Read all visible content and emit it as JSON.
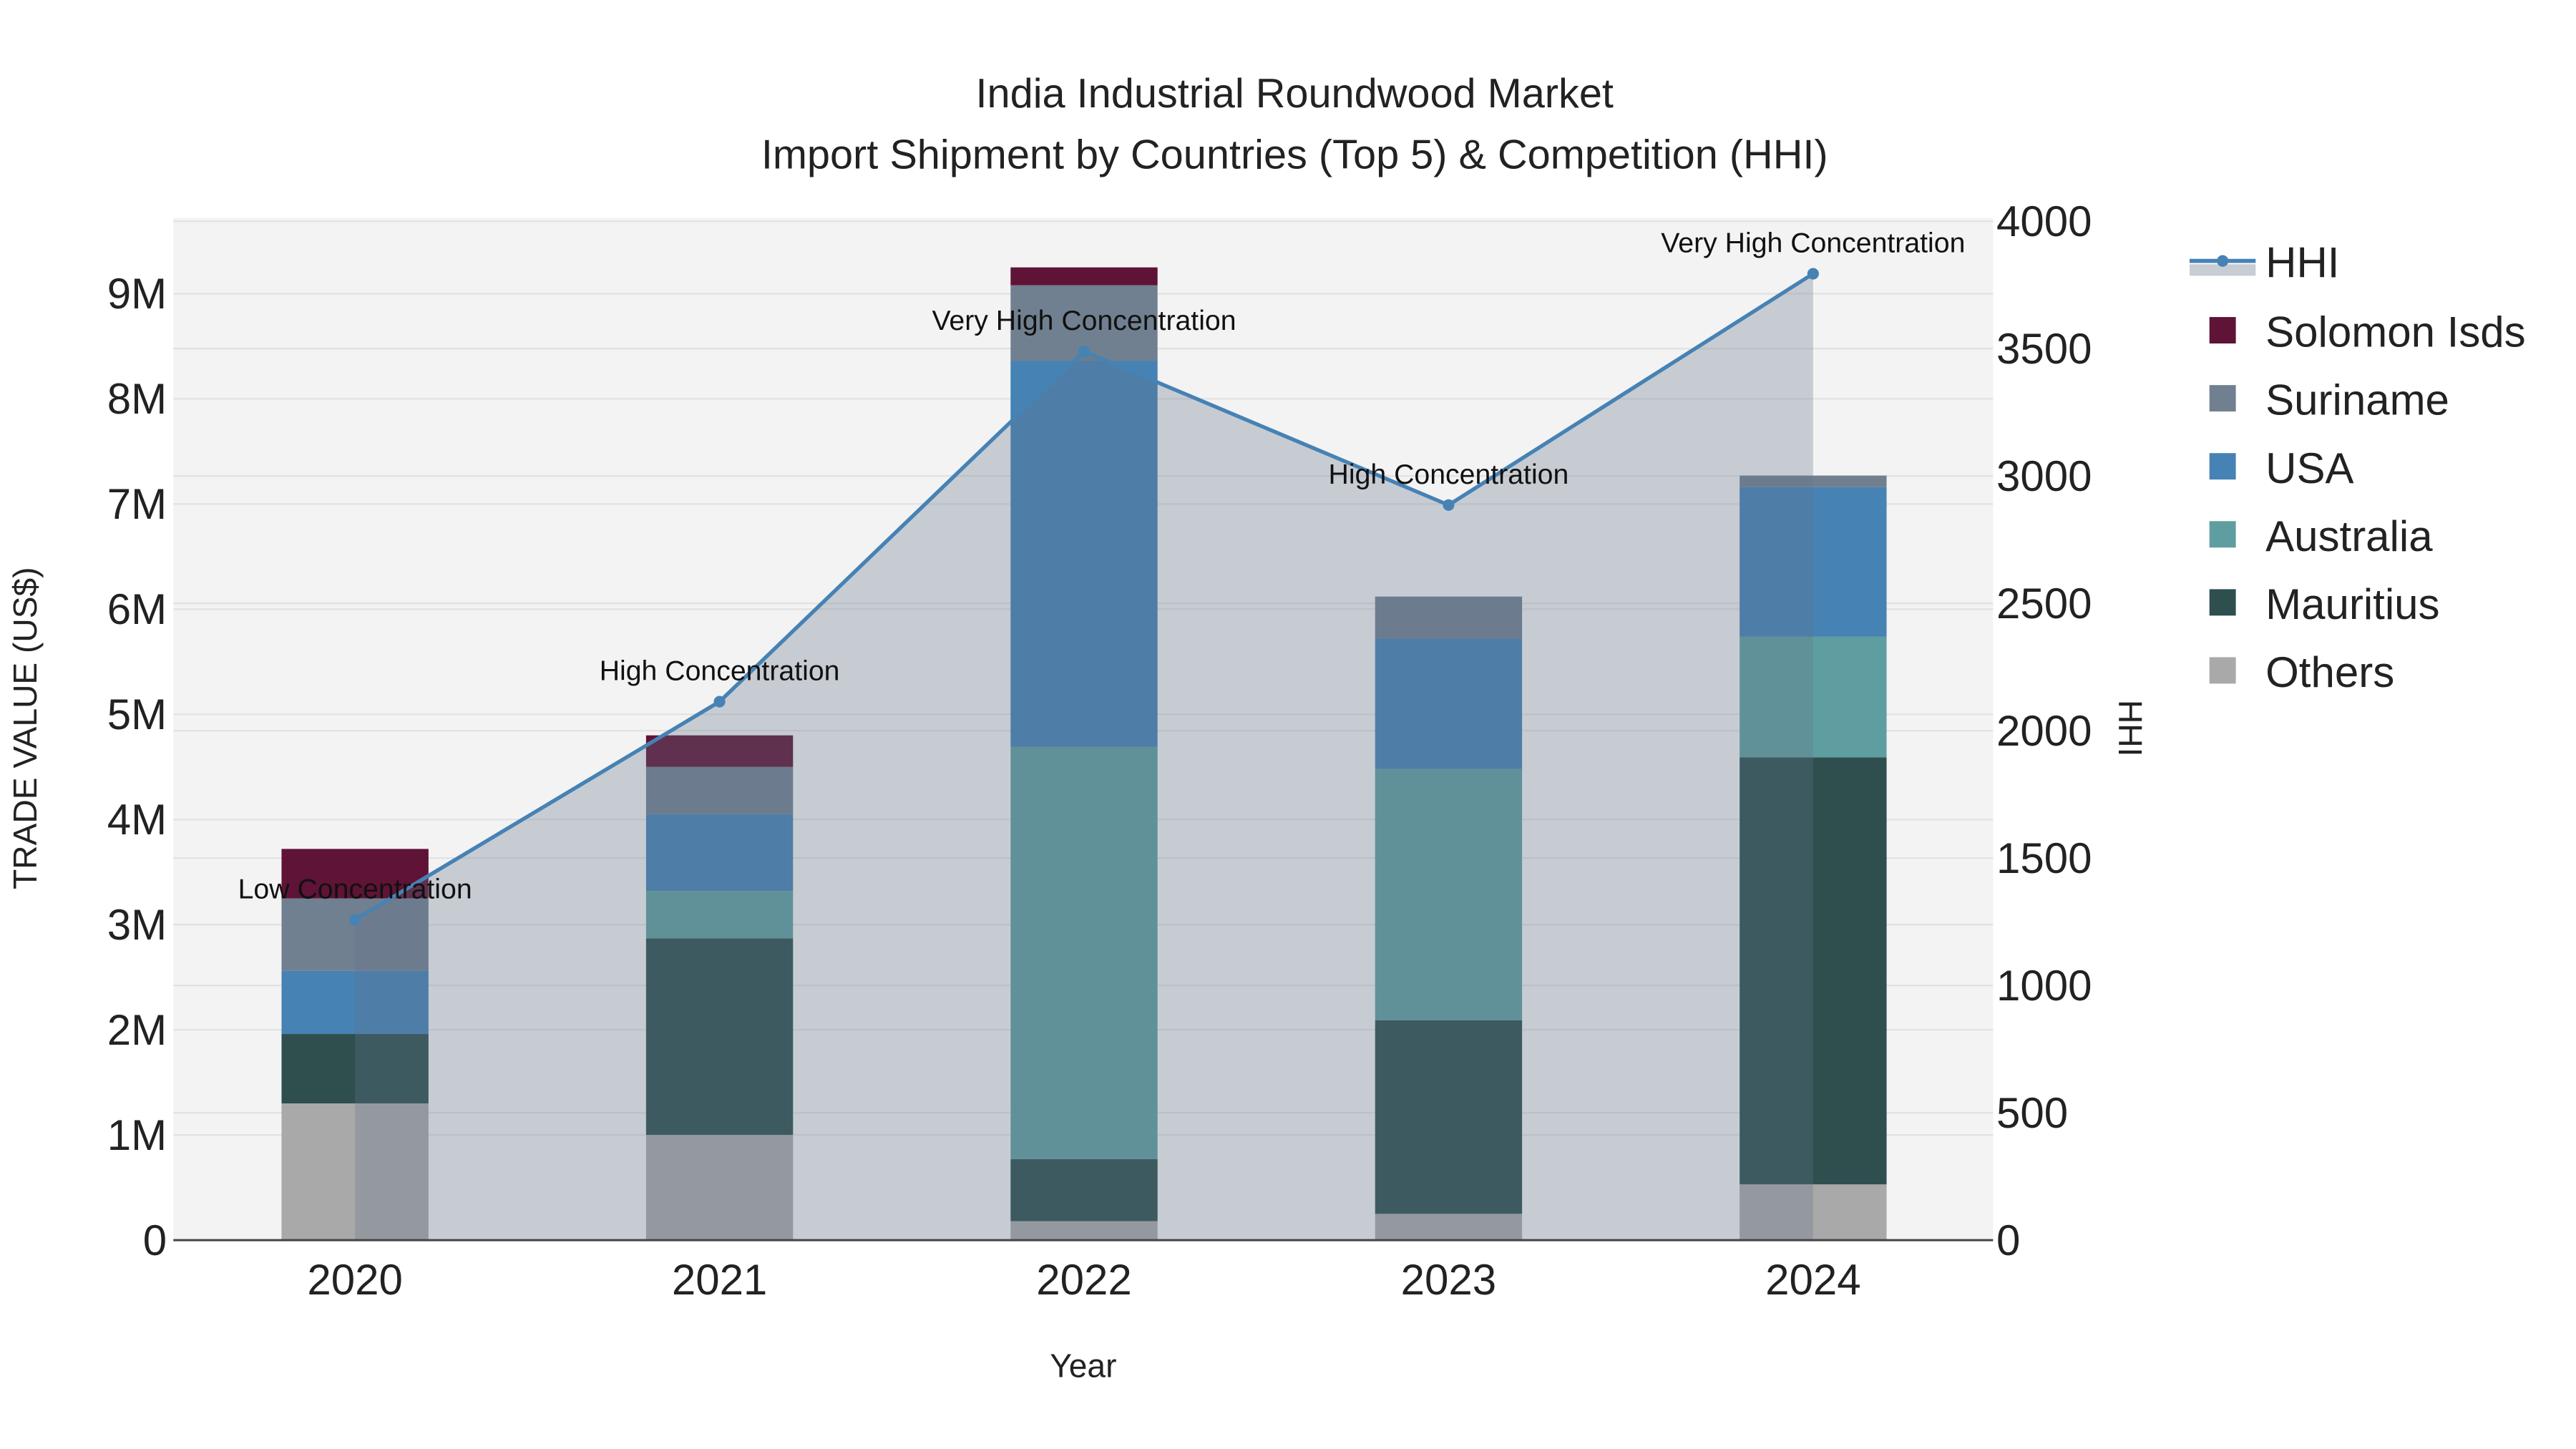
{
  "chart_data": {
    "type": "bar",
    "stacked": true,
    "title": "India Industrial Roundwood Market",
    "subtitle": "Import Shipment by Countries (Top 5) & Competition (HHI)",
    "xlabel": "Year",
    "ylabel": "TRADE VALUE (US$)",
    "y2label": "HHI",
    "categories": [
      "2020",
      "2021",
      "2022",
      "2023",
      "2024"
    ],
    "ylim": [
      0,
      9720000
    ],
    "y2lim": [
      0,
      4000
    ],
    "yticks": [
      {
        "v": 0,
        "label": "0"
      },
      {
        "v": 1000000,
        "label": "1M"
      },
      {
        "v": 2000000,
        "label": "2M"
      },
      {
        "v": 3000000,
        "label": "3M"
      },
      {
        "v": 4000000,
        "label": "4M"
      },
      {
        "v": 5000000,
        "label": "5M"
      },
      {
        "v": 6000000,
        "label": "6M"
      },
      {
        "v": 7000000,
        "label": "7M"
      },
      {
        "v": 8000000,
        "label": "8M"
      },
      {
        "v": 9000000,
        "label": "9M"
      }
    ],
    "y2ticks": [
      {
        "v": 0,
        "label": "0"
      },
      {
        "v": 500,
        "label": "500"
      },
      {
        "v": 1000,
        "label": "1000"
      },
      {
        "v": 1500,
        "label": "1500"
      },
      {
        "v": 2000,
        "label": "2000"
      },
      {
        "v": 2500,
        "label": "2500"
      },
      {
        "v": 3000,
        "label": "3000"
      },
      {
        "v": 3500,
        "label": "3500"
      },
      {
        "v": 4000,
        "label": "4000"
      }
    ],
    "series": [
      {
        "name": "Others",
        "color": "#a9a9a9",
        "values": [
          1300000,
          1000000,
          180000,
          250000,
          530000
        ]
      },
      {
        "name": "Mauritius",
        "color": "#2f4f4f",
        "values": [
          660000,
          1870000,
          590000,
          1840000,
          4060000
        ]
      },
      {
        "name": "Australia",
        "color": "#5f9ea0",
        "values": [
          0,
          450000,
          3920000,
          2390000,
          1150000
        ]
      },
      {
        "name": "USA",
        "color": "#4682b4",
        "values": [
          600000,
          730000,
          3670000,
          1240000,
          1420000
        ]
      },
      {
        "name": "Suriname",
        "color": "#708090",
        "values": [
          690000,
          450000,
          720000,
          400000,
          110000
        ]
      },
      {
        "name": "Solomon Isds",
        "color": "#5f1336",
        "values": [
          470000,
          300000,
          170000,
          0,
          0
        ]
      }
    ],
    "hhi": {
      "name": "HHI",
      "color": "#4682b4",
      "values": [
        1258,
        2114,
        3489,
        2886,
        3794
      ],
      "annotations": [
        "Low Concentration",
        "High Concentration",
        "Very High Concentration",
        "High Concentration",
        "Very High Concentration"
      ]
    },
    "legend_position": "right",
    "legend_order": [
      "HHI",
      "Solomon Isds",
      "Suriname",
      "USA",
      "Australia",
      "Mauritius",
      "Others"
    ]
  }
}
